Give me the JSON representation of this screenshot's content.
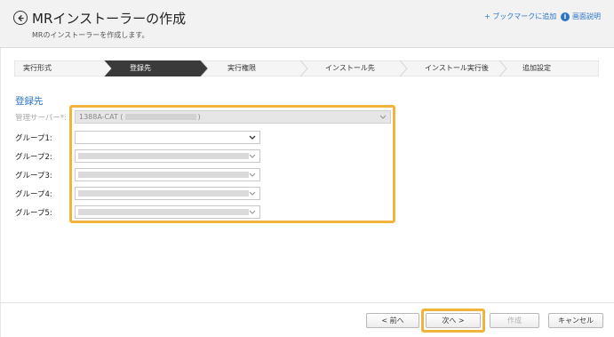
{
  "header": {
    "title": "MRインストーラーの作成",
    "subtitle": "MRのインストーラーを作成します。",
    "bookmark_link": "+ ブックマークに追加",
    "help_link": "画面説明",
    "help_icon": "info-icon"
  },
  "steps": [
    {
      "label": "実行形式",
      "active": false
    },
    {
      "label": "登録先",
      "active": true
    },
    {
      "label": "実行権限",
      "active": false
    },
    {
      "label": "インストール先",
      "active": false
    },
    {
      "label": "インストール実行後",
      "active": false
    },
    {
      "label": "追加設定",
      "active": false
    }
  ],
  "section": {
    "title": "登録先"
  },
  "form": {
    "server": {
      "label": "管理サーバー*:",
      "value": "1388A-CAT (",
      "value_suffix": ")",
      "disabled": true
    },
    "groups": [
      {
        "label": "グループ1:",
        "value": "",
        "disabled": false
      },
      {
        "label": "グループ2:",
        "value": "",
        "disabled": true
      },
      {
        "label": "グループ3:",
        "value": "",
        "disabled": true
      },
      {
        "label": "グループ4:",
        "value": "",
        "disabled": true
      },
      {
        "label": "グループ5:",
        "value": "",
        "disabled": true
      }
    ]
  },
  "footer": {
    "prev_button": "< 前へ",
    "next_button": "次へ >",
    "create_button": "作成",
    "cancel_button": "キャンセル"
  },
  "colors": {
    "accent": "#2a74c9",
    "active_step": "#3a3a3a",
    "highlight": "#f0b43c",
    "header_bg": "#f2f2f2"
  }
}
